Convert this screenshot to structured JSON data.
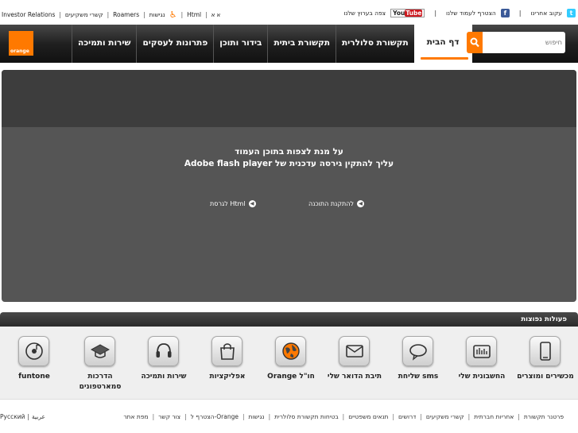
{
  "top_left": {
    "investor_relations": "Investor Relations",
    "investor_contact": "קשרי משקיעים",
    "roamers": "Roamers",
    "accessibility": "נגישות",
    "html": "Html",
    "font_size": "א א"
  },
  "top_right": {
    "follow": "עקוב אחרינו",
    "join_page": "הצטרף לעמוד שלנו",
    "youtube_you": "You",
    "youtube_tube": "Tube",
    "watch_channel": "צפה בערוץ שלנו"
  },
  "logo_text": "orange",
  "nav": {
    "items": [
      "דף הבית",
      "תקשורת סלולרית",
      "תקשורת ביתית",
      "בידור ותוכן",
      "פתרונות לעסקים",
      "שירות ותמיכה"
    ],
    "search_placeholder": "חיפוש"
  },
  "flash": {
    "line1": "על מנת לצפות בתוכן העמוד",
    "line2": "עליך להתקין גירסה עדכנית של Adobe flash player",
    "install_link": "להתקנת התוכנה",
    "html_link": "לגרסת Html"
  },
  "quick_actions": {
    "title": "פעולות נפוצות",
    "items": [
      {
        "label": "מכשירים ומוצרים",
        "icon": "phone-icon"
      },
      {
        "label": "החשבונית שלי",
        "icon": "invoice-icon"
      },
      {
        "label": "שליחת sms",
        "icon": "sms-bubble-icon"
      },
      {
        "label": "תיבת הדואר שלי",
        "icon": "mail-icon"
      },
      {
        "label": "Orange חו\"ל",
        "icon": "globe-icon"
      },
      {
        "label": "אפליקציות",
        "icon": "shopping-bag-icon"
      },
      {
        "label": "שירות ותמיכה",
        "icon": "headset-icon"
      },
      {
        "label": "הדרכות סמארטפונים",
        "icon": "graduation-cap-icon"
      },
      {
        "label": "funtone",
        "icon": "music-disc-icon"
      }
    ]
  },
  "footer": {
    "links": [
      "פרטנר תקשורת",
      "אחריות חברתית",
      "קשרי משקיעים",
      "דרושים",
      "תנאים משפטיים",
      "בטיחות תקשורת סלולרית",
      "נגישות",
      "הצטרף ל-Orange",
      "צור קשר",
      "מפת אתר"
    ],
    "lang_russian": "Русский",
    "lang_arabic": "عربية"
  },
  "colors": {
    "brand_orange": "#ff7900",
    "nav_dark": "#1e1e1e",
    "flash_gray": "#555555"
  }
}
